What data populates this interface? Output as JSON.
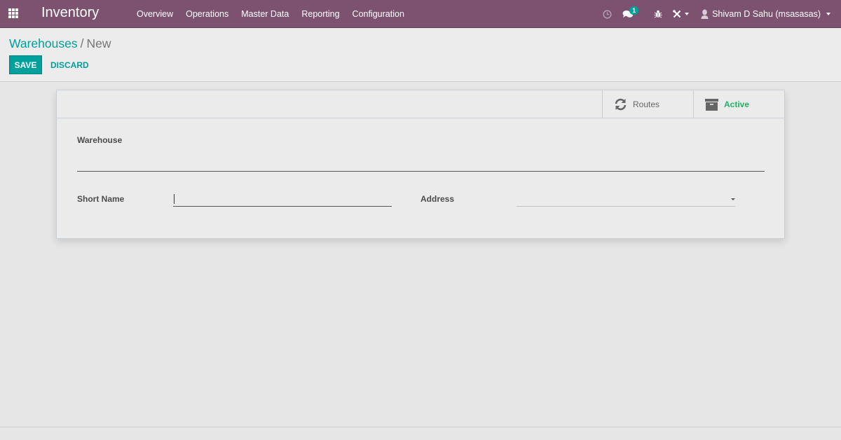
{
  "navbar": {
    "app_title": "Inventory",
    "menu": [
      {
        "label": "Overview"
      },
      {
        "label": "Operations"
      },
      {
        "label": "Master Data"
      },
      {
        "label": "Reporting"
      },
      {
        "label": "Configuration"
      }
    ],
    "systray": {
      "activity_icon": "clock-icon",
      "messages_icon": "comments-icon",
      "messages_count": "1",
      "debug_icon": "bug-icon",
      "tools_icon": "tools-icon",
      "user_name": "Shivam D Sahu (msasasas)"
    }
  },
  "control_panel": {
    "breadcrumb": [
      {
        "label": "Warehouses"
      },
      {
        "label": "New"
      }
    ],
    "breadcrumb_separator": "/",
    "save_label": "SAVE",
    "discard_label": "DISCARD"
  },
  "form": {
    "stat_buttons": [
      {
        "label": "Routes",
        "icon": "refresh-icon"
      },
      {
        "label": "Active",
        "icon": "archive-icon"
      }
    ],
    "fields": {
      "warehouse": {
        "label": "Warehouse",
        "value": ""
      },
      "short_name": {
        "label": "Short Name",
        "value": ""
      },
      "address": {
        "label": "Address",
        "value": ""
      }
    }
  },
  "colors": {
    "navbar": "#7c526f",
    "primary": "#00a09d",
    "active_green": "#21b268"
  }
}
